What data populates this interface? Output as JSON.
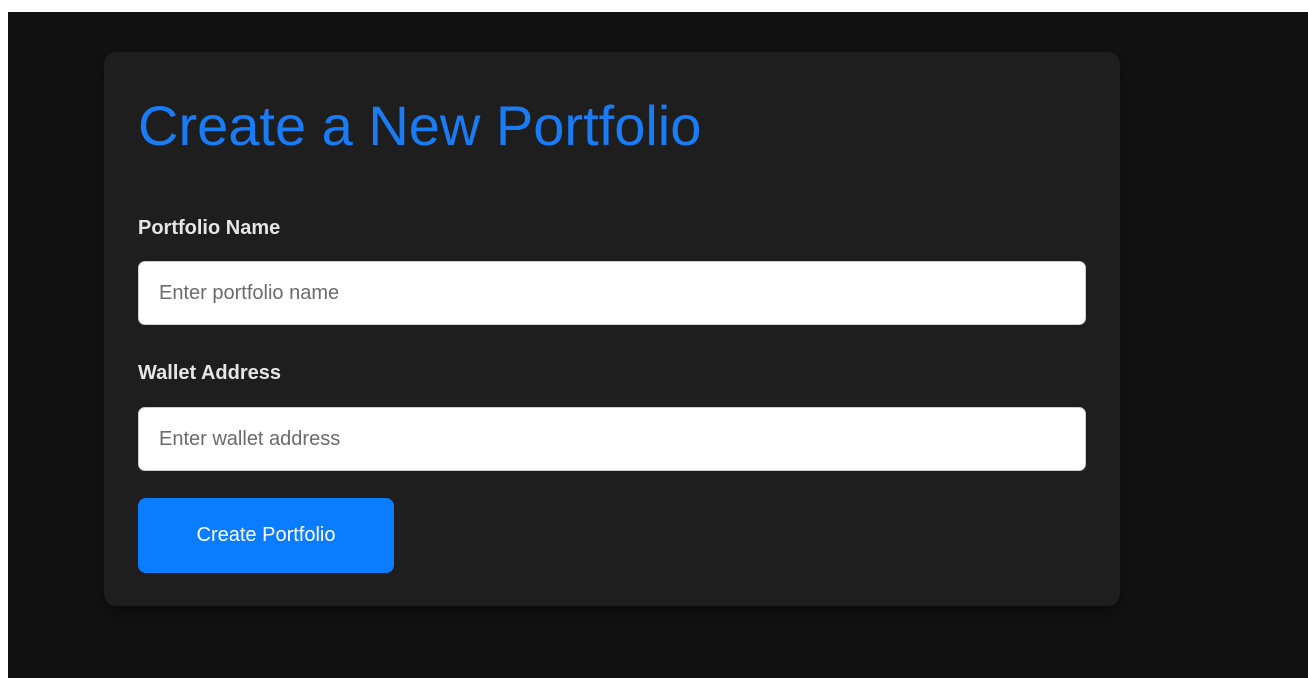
{
  "page": {
    "title": "Create a New Portfolio"
  },
  "form": {
    "portfolio_name": {
      "label": "Portfolio Name",
      "value": "",
      "placeholder": "Enter portfolio name"
    },
    "wallet_address": {
      "label": "Wallet Address",
      "value": "",
      "placeholder": "Enter wallet address"
    },
    "submit_label": "Create Portfolio"
  },
  "colors": {
    "page_background": "#121212",
    "card_background": "#1e1e1e",
    "accent": "#0a7cff",
    "title": "#1a7cf5",
    "label_text": "#e6e6e6",
    "input_background": "#ffffff",
    "placeholder_text": "#6b6b6b"
  }
}
